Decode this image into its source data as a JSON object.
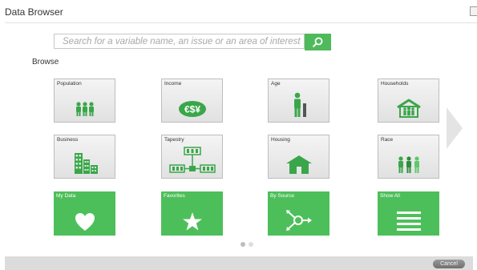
{
  "window": {
    "title": "Data Browser"
  },
  "search": {
    "placeholder": "Search for a variable name, an issue or an area of interest"
  },
  "browse_label": "Browse",
  "tiles": [
    {
      "label": "Population",
      "icon": "population-icon",
      "style": "gray"
    },
    {
      "label": "Income",
      "icon": "income-icon",
      "style": "gray"
    },
    {
      "label": "Age",
      "icon": "age-icon",
      "style": "gray"
    },
    {
      "label": "Households",
      "icon": "households-icon",
      "style": "gray"
    },
    {
      "label": "Business",
      "icon": "business-icon",
      "style": "gray"
    },
    {
      "label": "Tapestry",
      "icon": "tapestry-icon",
      "style": "gray"
    },
    {
      "label": "Housing",
      "icon": "housing-icon",
      "style": "gray"
    },
    {
      "label": "Race",
      "icon": "race-icon",
      "style": "gray"
    },
    {
      "label": "My Data",
      "icon": "heart-icon",
      "style": "green"
    },
    {
      "label": "Favorites",
      "icon": "star-icon",
      "style": "green"
    },
    {
      "label": "By Source",
      "icon": "source-icon",
      "style": "green"
    },
    {
      "label": "Show All",
      "icon": "list-icon",
      "style": "green"
    }
  ],
  "pagination": {
    "pages": 2,
    "current": 1
  },
  "footer": {
    "cancel_label": "Cancel"
  },
  "colors": {
    "accent": "#4dbf5a",
    "icon_green": "#3aa64a"
  }
}
